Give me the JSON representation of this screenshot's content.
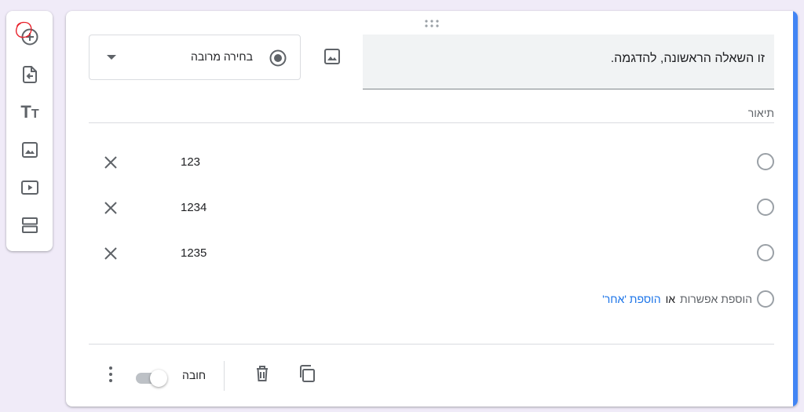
{
  "question": {
    "title": "זו השאלה הראשונה, להדגמה.",
    "type_label": "בחירה מרובה",
    "description_placeholder": "תיאור"
  },
  "options": [
    {
      "label": "123"
    },
    {
      "label": "1234"
    },
    {
      "label": "1235"
    }
  ],
  "add": {
    "add_option_label": "הוספת אפשרות",
    "or_label": "או",
    "add_other_label": "הוספת 'אחר'"
  },
  "footer": {
    "required_label": "חובה",
    "required_on": false
  },
  "colors": {
    "accent": "#4285f4",
    "link": "#1a73e8",
    "background": "#f0ebf8",
    "annotation": "#e8202a"
  },
  "icons": {
    "toolbar": [
      "add-question-icon",
      "import-questions-icon",
      "add-title-icon",
      "add-image-icon",
      "add-video-icon",
      "add-section-icon"
    ],
    "card": [
      "drag-handle-icon",
      "add-image-icon",
      "radio-checked-icon",
      "dropdown-arrow-icon",
      "close-icon",
      "copy-icon",
      "delete-icon",
      "more-vert-icon"
    ]
  }
}
